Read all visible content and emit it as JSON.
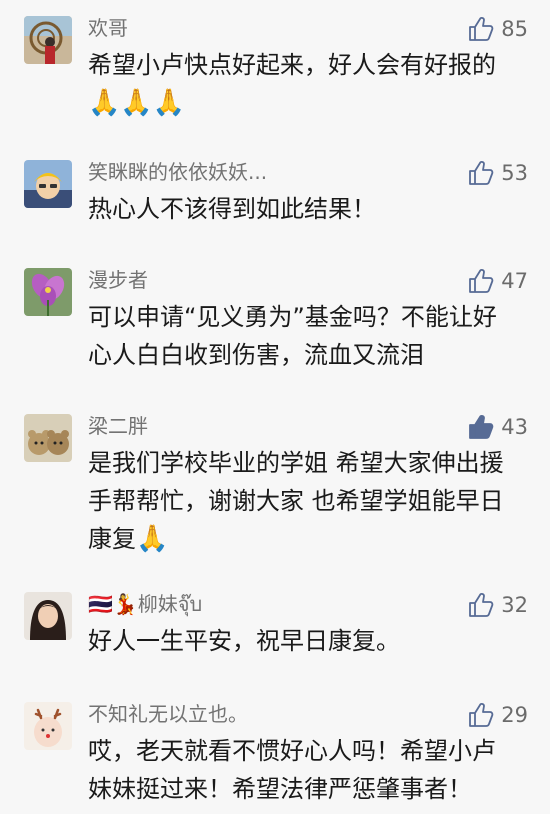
{
  "comments": [
    {
      "avatar_icon": "photo-avatar-person-icon",
      "username": "欢哥",
      "likes": "85",
      "liked": false,
      "text": "希望小卢快点好起来，好人会有好报的",
      "emoji": "🙏🙏🙏"
    },
    {
      "avatar_icon": "photo-avatar-child-icon",
      "username": "笑眯眯的依依妖妖...",
      "likes": "53",
      "liked": false,
      "text": "热心人不该得到如此结果！",
      "emoji": ""
    },
    {
      "avatar_icon": "photo-avatar-flower-icon",
      "username": "漫步者",
      "likes": "47",
      "liked": false,
      "text": "可以申请“见义勇为”基金吗？不能让好\n心人白白收到伤害，流血又流泪",
      "emoji": ""
    },
    {
      "avatar_icon": "photo-avatar-bears-icon",
      "username": "梁二胖",
      "likes": "43",
      "liked": true,
      "text": "是我们学校毕业的学姐 希望大家伸出援\n手帮帮忙，谢谢大家 也希望学姐能早日\n康复",
      "emoji": "🙏"
    },
    {
      "avatar_icon": "photo-avatar-woman-icon",
      "username": "🇹🇭💃柳妹จุ๊บ",
      "likes": "32",
      "liked": false,
      "text": "好人一生平安，祝早日康复。",
      "emoji": ""
    },
    {
      "avatar_icon": "photo-avatar-baby-reindeer-icon",
      "username": "不知礼无以立也。",
      "likes": "29",
      "liked": false,
      "text": "哎，老天就看不惯好心人吗！希望小卢\n妹妹挺过来！希望法律严惩肇事者！",
      "emoji": ""
    }
  ],
  "colors": {
    "background": "#f7f7f7",
    "username": "#737373",
    "text": "#1a1a1a",
    "like_icon_outline": "#576b95",
    "like_icon_filled": "#576b95"
  }
}
